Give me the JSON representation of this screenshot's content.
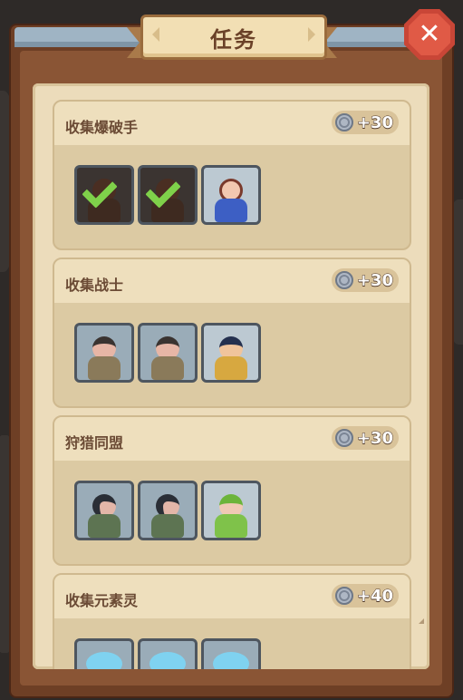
{
  "title": "任务",
  "colors": {
    "frame": "#6e3f25",
    "paper": "#ecdcbb",
    "reward_text": "#ffffff",
    "check": "#7fd14a",
    "close_button": "#c94637"
  },
  "close_icon": "✕",
  "quests": [
    {
      "title": "收集爆破手",
      "reward": "+30",
      "slots": [
        {
          "icon": "bomber-icon",
          "state": "collected"
        },
        {
          "icon": "bomber-icon",
          "state": "collected"
        },
        {
          "icon": "bomber-leader-icon",
          "state": "not-collected"
        }
      ]
    },
    {
      "title": "收集战士",
      "reward": "+30",
      "slots": [
        {
          "icon": "warrior-icon",
          "state": "not-collected"
        },
        {
          "icon": "warrior-icon",
          "state": "not-collected"
        },
        {
          "icon": "warrior-leader-icon",
          "state": "not-collected"
        }
      ]
    },
    {
      "title": "狩猎同盟",
      "reward": "+30",
      "slots": [
        {
          "icon": "huntress-icon",
          "state": "not-collected"
        },
        {
          "icon": "huntress-icon",
          "state": "not-collected"
        },
        {
          "icon": "archer-icon",
          "state": "not-collected"
        }
      ]
    },
    {
      "title": "收集元素灵",
      "reward": "+40",
      "slots": [
        {
          "icon": "elemental-icon",
          "state": "not-collected"
        },
        {
          "icon": "elemental-icon",
          "state": "not-collected"
        },
        {
          "icon": "elemental-icon",
          "state": "not-collected"
        }
      ]
    }
  ]
}
